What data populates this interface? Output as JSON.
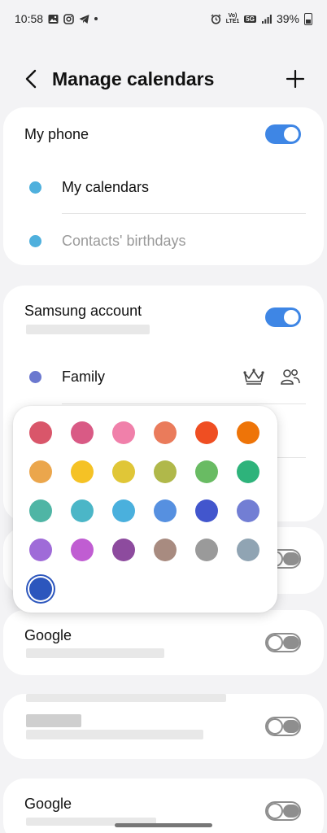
{
  "status": {
    "time": "10:58",
    "signal_tag_top": "Vo)",
    "signal_tag_bottom": "LTE1",
    "network": "5G",
    "battery": "39%"
  },
  "header": {
    "title": "Manage calendars"
  },
  "my_phone": {
    "title": "My phone",
    "toggle_on": true,
    "items": [
      {
        "label": "My calendars",
        "color": "#4fb0dd",
        "muted": false
      },
      {
        "label": "Contacts' birthdays",
        "color": "#4fb0dd",
        "muted": true
      }
    ]
  },
  "samsung": {
    "title": "Samsung account",
    "toggle_on": true,
    "items": [
      {
        "label": "Family",
        "color": "#6b78cf"
      }
    ]
  },
  "google_1": {
    "title": "Google",
    "toggle_on": false
  },
  "account_blurred": {
    "toggle_on": false
  },
  "google_2": {
    "title": "Google",
    "toggle_on": false
  },
  "hidden_card_toggle_on": false,
  "palette": {
    "colors": [
      "#d9566a",
      "#d95a85",
      "#f080aa",
      "#ea7b5b",
      "#ef4e22",
      "#ee7408",
      "#eba64c",
      "#f5c225",
      "#e0c637",
      "#b0b84a",
      "#69bb63",
      "#2eb37b",
      "#4fb5a5",
      "#4bb6c7",
      "#4ab0dd",
      "#5690e0",
      "#4256cd",
      "#727ed4",
      "#9f6bd8",
      "#c05dd2",
      "#8d4b9e",
      "#a88b80",
      "#9a9a9a",
      "#90a4b3",
      "#2c56bd"
    ],
    "selected_index": 24
  }
}
